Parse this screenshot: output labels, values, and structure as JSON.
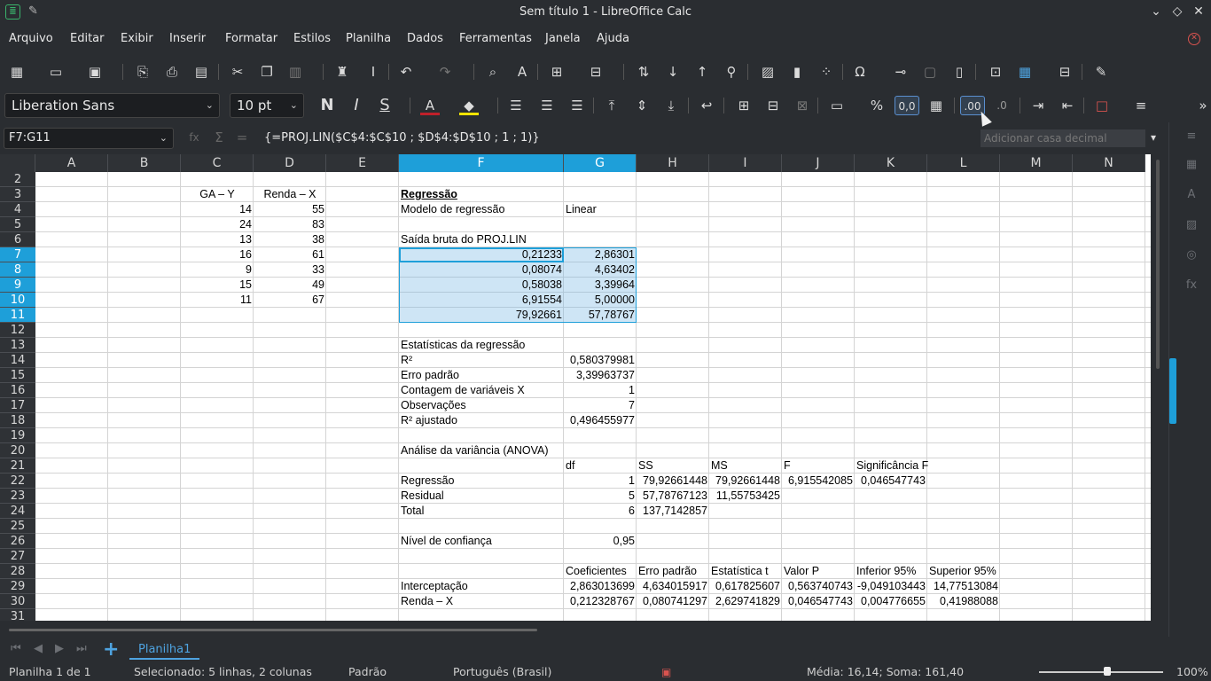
{
  "window": {
    "title": "Sem título 1 - LibreOffice Calc"
  },
  "menu": [
    "Arquivo",
    "Editar",
    "Exibir",
    "Inserir",
    "Formatar",
    "Estilos",
    "Planilha",
    "Dados",
    "Ferramentas",
    "Janela",
    "Ajuda"
  ],
  "toolbar": {
    "font_name": "Liberation Sans",
    "font_size": "10 pt",
    "bold_label": "N",
    "italic_label": "I",
    "strike_label": "S",
    "percent_label": "%",
    "number_label": "0,0",
    "add_decimal_label": ".00",
    "remove_decimal_label": ".0"
  },
  "formula_bar": {
    "name_box": "F7:G11",
    "formula": "{=PROJ.LIN($C$4:$C$10 ; $D$4:$D$10 ; 1 ; 1)}",
    "tooltip": "Adicionar casa decimal"
  },
  "columns": [
    "A",
    "B",
    "C",
    "D",
    "E",
    "F",
    "G",
    "H",
    "I",
    "J",
    "K",
    "L",
    "M",
    "N"
  ],
  "rows": [
    "2",
    "3",
    "4",
    "5",
    "6",
    "7",
    "8",
    "9",
    "10",
    "11",
    "12",
    "13",
    "14",
    "15",
    "16",
    "17",
    "18",
    "19",
    "20",
    "21",
    "22",
    "23",
    "24",
    "25",
    "26",
    "27",
    "28",
    "29",
    "30",
    "31"
  ],
  "cells": {
    "C3": "GA – Y",
    "D3": "Renda – X",
    "C4": "14",
    "D4": "55",
    "C5": "24",
    "D5": "83",
    "C6": "13",
    "D6": "38",
    "C7": "16",
    "D7": "61",
    "C8": "9",
    "D8": "33",
    "C9": "15",
    "D9": "49",
    "C10": "11",
    "D10": "67",
    "F3": "Regressão",
    "F4": "Modelo de regressão",
    "G4": "Linear",
    "F6": "Saída bruta do PROJ.LIN",
    "F7": "0,21233",
    "G7": "2,86301",
    "F8": "0,08074",
    "G8": "4,63402",
    "F9": "0,58038",
    "G9": "3,39964",
    "F10": "6,91554",
    "G10": "5,00000",
    "F11": "79,92661",
    "G11": "57,78767",
    "F13": "Estatísticas da regressão",
    "F14": "R²",
    "G14": "0,580379981",
    "F15": "Erro padrão",
    "G15": "3,39963737",
    "F16": "Contagem de variáveis X",
    "G16": "1",
    "F17": "Observações",
    "G17": "7",
    "F18": "R² ajustado",
    "G18": "0,496455977",
    "F20": "Análise da variância (ANOVA)",
    "G21": "df",
    "H21": "SS",
    "I21": "MS",
    "J21": "F",
    "K21": "Significância F",
    "F22": "Regressão",
    "G22": "1",
    "H22": "79,92661448",
    "I22": "79,92661448",
    "J22": "6,915542085",
    "K22": "0,046547743",
    "F23": "Residual",
    "G23": "5",
    "H23": "57,78767123",
    "I23": "11,55753425",
    "F24": "Total",
    "G24": "6",
    "H24": "137,7142857",
    "F26": "Nível de confiança",
    "G26": "0,95",
    "G28": "Coeficientes",
    "H28": "Erro padrão",
    "I28": "Estatística t",
    "J28": "Valor P",
    "K28": "Inferior 95%",
    "L28": "Superior 95%",
    "F29": "Interceptação",
    "G29": "2,863013699",
    "H29": "4,634015917",
    "I29": "0,617825607",
    "J29": "0,563740743",
    "K29": "-9,049103443",
    "L29": "14,77513084",
    "F30": "Renda – X",
    "G30": "0,212328767",
    "H30": "0,080741297",
    "I30": "2,629741829",
    "J30": "0,046547743",
    "K30": "0,004776655",
    "L30": "0,41988088"
  },
  "sheet_tabs": [
    "Planilha1"
  ],
  "status": {
    "sheet": "Planilha 1 de 1",
    "selection": "Selecionado: 5 linhas, 2 colunas",
    "style": "Padrão",
    "language": "Português (Brasil)",
    "sum": "Média: 16,14; Soma: 161,40",
    "zoom": "100%"
  }
}
